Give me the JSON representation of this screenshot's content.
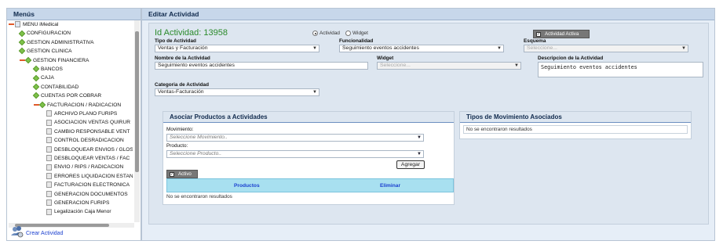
{
  "left_panel": {
    "title": "Menús",
    "tree": [
      {
        "label": "MENU iMedical",
        "kind": "root",
        "level": 0
      },
      {
        "label": "CONFIGURACION",
        "kind": "folder",
        "level": 1
      },
      {
        "label": "GESTION ADMINISTRATIVA",
        "kind": "folder",
        "level": 1
      },
      {
        "label": "GESTION CLINICA",
        "kind": "folder",
        "level": 1
      },
      {
        "label": "GESTION FINANCIERA",
        "kind": "expanded",
        "level": 1
      },
      {
        "label": "BANCOS",
        "kind": "folder",
        "level": 2
      },
      {
        "label": "CAJA",
        "kind": "folder",
        "level": 2
      },
      {
        "label": "CONTABILIDAD",
        "kind": "folder",
        "level": 2
      },
      {
        "label": "CUENTAS POR COBRAR",
        "kind": "folder",
        "level": 2
      },
      {
        "label": "FACTURACION / RADICACION",
        "kind": "expanded",
        "level": 2
      },
      {
        "label": "ARCHIVO PLANO FURIPS",
        "kind": "page",
        "level": 3
      },
      {
        "label": "ASOCIACION VENTAS QUIRUR",
        "kind": "page",
        "level": 3
      },
      {
        "label": "CAMBIO RESPONSABLE VENT",
        "kind": "page",
        "level": 3
      },
      {
        "label": "CONTROL DESRADICACION",
        "kind": "page",
        "level": 3
      },
      {
        "label": "DESBLOQUEAR ENVIOS / GLOS",
        "kind": "page",
        "level": 3
      },
      {
        "label": "DESBLOQUEAR VENTAS / FAC",
        "kind": "page",
        "level": 3
      },
      {
        "label": "ENVIO / RIPS / RADICACION",
        "kind": "page",
        "level": 3
      },
      {
        "label": "ERRORES LIQUIDACION ESTAN",
        "kind": "page",
        "level": 3
      },
      {
        "label": "FACTURACION ELECTRONICA",
        "kind": "page",
        "level": 3
      },
      {
        "label": "GENERACION DOCUMENTOS",
        "kind": "page",
        "level": 3
      },
      {
        "label": "GENERACION FURIPS",
        "kind": "page",
        "level": 3
      },
      {
        "label": "Legalización Caja Menor",
        "kind": "page",
        "level": 3
      }
    ],
    "create_link": "Crear Actividad",
    "create_icon": "users-gear-icon"
  },
  "main": {
    "title": "Editar Actividad",
    "id_label": "Id Actividad: 13958",
    "radio_actividad": "Actividad",
    "radio_widget": "Widget",
    "active_toggle": "Actividad Activa",
    "tipo": {
      "label": "Tipo de Actividad",
      "value": "Ventas y Facturación"
    },
    "funcionalidad": {
      "label": "Funcionalidad",
      "value": "Seguimiento eventos accidentes"
    },
    "esquema": {
      "label": "Esquema",
      "placeholder": "Seleccione..."
    },
    "nombre": {
      "label": "Nombre de la Actividad",
      "value": "Seguimiento eventos accidentes"
    },
    "widget": {
      "label": "Widget",
      "placeholder": "Seleccione..."
    },
    "descripcion": {
      "label": "Descripcion de la Actividad",
      "value": "Seguimiento eventos accidentes"
    },
    "categoria": {
      "label": "Categoria de Actividad",
      "value": "Ventas-Facturación"
    },
    "productos_panel": {
      "title": "Asociar Productos a Actividades",
      "movimiento_label": "Movimiento:",
      "movimiento_placeholder": "Seleccione Movimiento..",
      "producto_label": "Producto:",
      "producto_placeholder": "Seleccione Producto..",
      "add_button": "Agregar",
      "activo_toggle": "Activo",
      "col_productos": "Productos",
      "col_eliminar": "Eliminar",
      "empty": "No se encontraron resultados"
    },
    "movimientos_panel": {
      "title": "Tipos de Movimiento Asociados",
      "empty": "No se encontraron resultados"
    }
  },
  "colors": {
    "accent_green": "#2a8a2a",
    "header_bg": "#c7d7ea",
    "table_header": "#a8e0f0"
  }
}
